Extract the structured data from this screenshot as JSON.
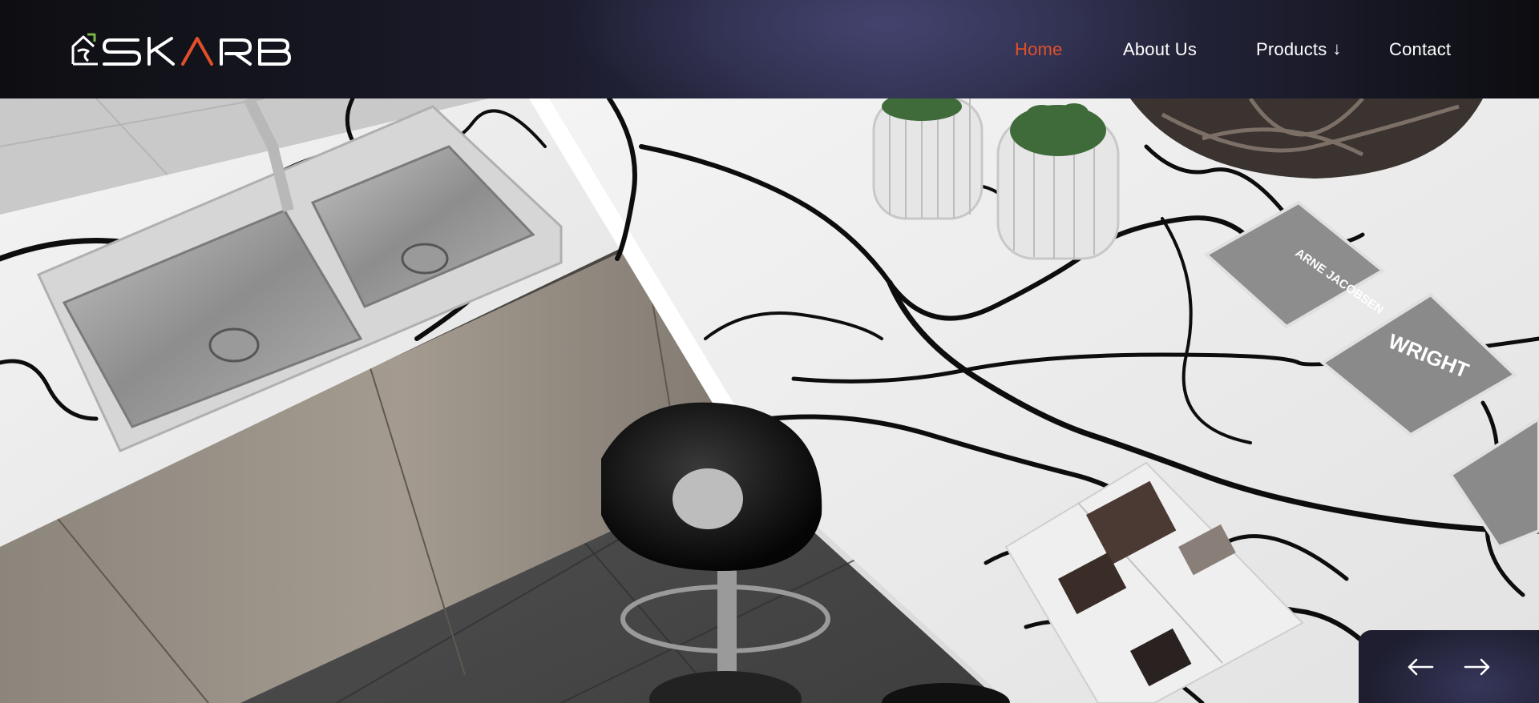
{
  "brand": {
    "logo_text": "SKARB",
    "accent_color": "#e2502a"
  },
  "nav": {
    "items": [
      {
        "label": "Home",
        "active": true
      },
      {
        "label": "About Us",
        "active": false
      },
      {
        "label": "Products",
        "active": false,
        "dropdown_icon": "arrow-down-icon"
      },
      {
        "label": "Contact",
        "active": false
      }
    ]
  },
  "hero": {
    "image": "kitchen-marble-countertop-hero",
    "books": [
      "ARNE JACOBSEN",
      "WRIGHT"
    ]
  },
  "slider": {
    "prev_icon": "arrow-left-icon",
    "next_icon": "arrow-right-icon"
  }
}
